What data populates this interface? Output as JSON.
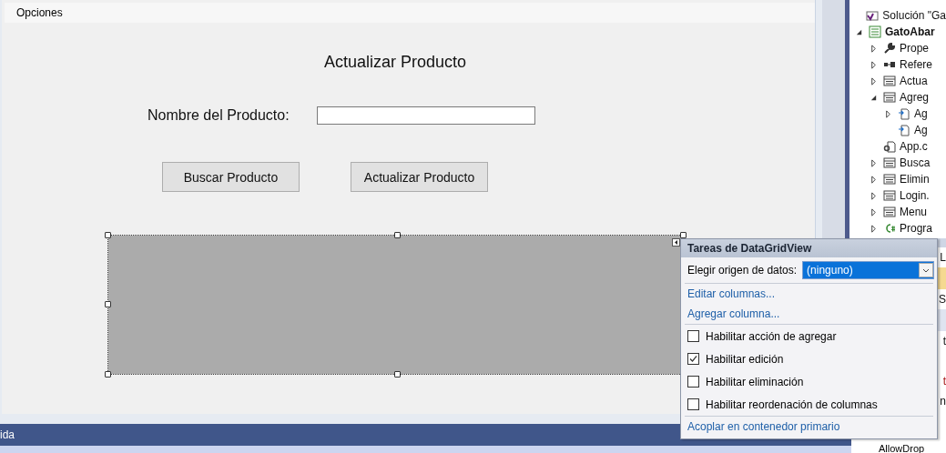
{
  "designer": {
    "menu": [
      "Opciones"
    ],
    "title": "Actualizar Producto",
    "field": {
      "label": "Nombre del Producto:"
    },
    "buttons": [
      "Buscar Producto",
      "Actualizar Producto"
    ],
    "grid": {
      "selected": true
    }
  },
  "tasks": {
    "title": "Tareas de DataGridView",
    "data_source": {
      "label": "Elegir origen de datos:",
      "value": "(ninguno)"
    },
    "links": [
      "Editar columnas...",
      "Agregar columna..."
    ],
    "options": [
      {
        "label": "Habilitar acción de agregar",
        "checked": false
      },
      {
        "label": "Habilitar edición",
        "checked": true
      },
      {
        "label": "Habilitar eliminación",
        "checked": false
      },
      {
        "label": "Habilitar reordenación de columnas",
        "checked": false
      }
    ],
    "dock_link": "Acoplar en contenedor primario"
  },
  "solution_explorer": {
    "tree": [
      {
        "label": "Solución \"Ga",
        "kind": "solution"
      },
      {
        "label": "GatoAbar",
        "kind": "project",
        "expanded": true,
        "children": [
          {
            "label": "Prope",
            "kind": "properties",
            "expanded": false
          },
          {
            "label": "Refere",
            "kind": "references",
            "expanded": false
          },
          {
            "label": "Actua",
            "kind": "form",
            "expanded": false
          },
          {
            "label": "Agreg",
            "kind": "form",
            "expanded": true,
            "children": [
              {
                "label": "Ag",
                "kind": "file",
                "expanded": false
              },
              {
                "label": "Ag",
                "kind": "file"
              }
            ]
          },
          {
            "label": "App.c",
            "kind": "config"
          },
          {
            "label": "Busca",
            "kind": "form",
            "expanded": false
          },
          {
            "label": "Elimin",
            "kind": "form",
            "expanded": false
          },
          {
            "label": "Login.",
            "kind": "form",
            "expanded": false
          },
          {
            "label": "Menu",
            "kind": "form",
            "expanded": false
          },
          {
            "label": "Progra",
            "kind": "code",
            "expanded": false
          }
        ]
      }
    ]
  },
  "properties": {
    "rows": [
      {
        "text": "L",
        "kind": "plain"
      },
      {
        "kind": "highlight"
      },
      {
        "text": "S",
        "kind": "plain"
      },
      {
        "kind": "category"
      },
      {
        "text": "t",
        "kind": "plain"
      },
      {
        "kind": "plain"
      },
      {
        "text": "t",
        "kind": "red"
      },
      {
        "text": "n",
        "kind": "plain"
      }
    ],
    "last_row": "AllowDrop"
  },
  "output_panel": {
    "title": "ida"
  }
}
